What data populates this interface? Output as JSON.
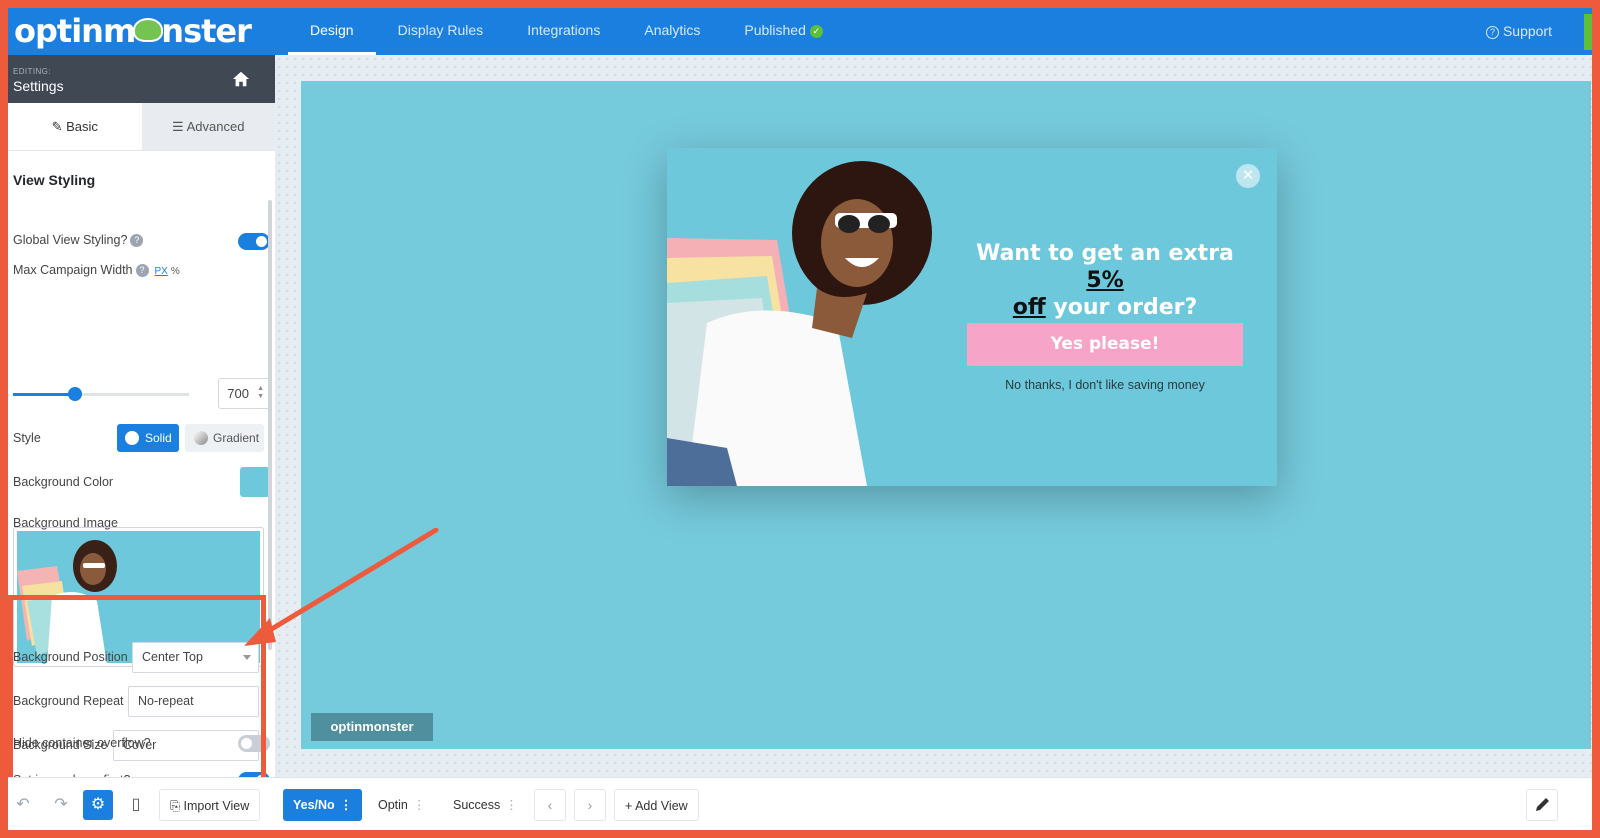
{
  "topbar": {
    "logo": "optinmonster",
    "tabs": [
      {
        "label": "Design",
        "active": true
      },
      {
        "label": "Display Rules"
      },
      {
        "label": "Integrations"
      },
      {
        "label": "Analytics"
      },
      {
        "label": "Published"
      }
    ],
    "support": "Support"
  },
  "sidebar": {
    "editing_label": "EDITING:",
    "editing_title": "Settings",
    "tabs": [
      {
        "label": "Basic"
      },
      {
        "label": "Advanced"
      }
    ],
    "section_title": "View Styling",
    "global_view_styling": "Global View Styling?",
    "max_width_label": "Max Campaign Width",
    "unit_px": "PX",
    "unit_pct": "%",
    "max_width_value": "700",
    "max_width_fraction": 0.35,
    "style_label": "Style",
    "style_solid": "Solid",
    "style_gradient": "Gradient",
    "bg_color_label": "Background Color",
    "bg_color_value": "#6ec8db",
    "bg_image_label": "Background Image",
    "bg_position_label": "Background Position",
    "bg_position_value": "Center Top",
    "bg_repeat_label": "Background Repeat",
    "bg_repeat_value": "No-repeat",
    "bg_size_label": "Background Size",
    "bg_size_value": "Cover",
    "image_layer_first": "Set image layer first?",
    "hide_overflow": "Hide container overflow?"
  },
  "popup": {
    "headline_a": "Want to get an extra ",
    "headline_b": "5%",
    "headline_c": "off",
    "headline_d": " your order?",
    "cta": "Yes please!",
    "decline": "No thanks, I don't like saving money",
    "watermark": "optinmonster"
  },
  "bottombar": {
    "import_view": "Import View",
    "views": [
      {
        "label": "Yes/No",
        "active": true
      },
      {
        "label": "Optin"
      },
      {
        "label": "Success"
      }
    ],
    "add_view": "Add View"
  },
  "colors": {
    "brand_blue": "#1b7fe0",
    "popup_teal": "#6ec8db",
    "cta_pink": "#f6a4c8",
    "highlight": "#ee5a3c"
  }
}
